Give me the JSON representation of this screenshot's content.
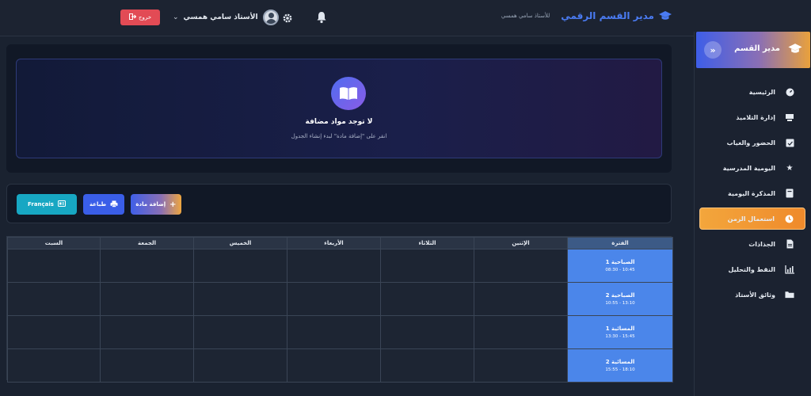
{
  "header": {
    "app_title": "مدير القسم الرقمي",
    "teacher_subtitle": "للأستاذ سامي همسي",
    "user_name": "الأستاذ سامي همسي",
    "logout_label": "خروج"
  },
  "sidebar": {
    "title": "مدير القسم",
    "items": [
      {
        "label": "الرئيسية",
        "icon": "dashboard-icon"
      },
      {
        "label": "إدارة التلاميذ",
        "icon": "students-icon"
      },
      {
        "label": "الحضور والغياب",
        "icon": "calendar-check-icon"
      },
      {
        "label": "اليومية المدرسية",
        "icon": "star-icon"
      },
      {
        "label": "المذكرة اليومية",
        "icon": "notebook-icon"
      },
      {
        "label": "استعمال الزمن",
        "icon": "clock-icon",
        "active": true
      },
      {
        "label": "الجذاذات",
        "icon": "file-icon"
      },
      {
        "label": "النقط والتحليل",
        "icon": "chart-icon"
      },
      {
        "label": "وثائق الأستاذ",
        "icon": "folder-icon"
      }
    ]
  },
  "empty_state": {
    "title": "لا توجد مواد مضافة",
    "subtitle": "انقر على \"إضافة مادة\" لبدء إنشاء الجدول"
  },
  "actions": {
    "french_label": "Français",
    "print_label": "طباعة",
    "add_subject_label": "إضافة مادة"
  },
  "timetable": {
    "columns": [
      "السبت",
      "الجمعة",
      "الخميس",
      "الأربعاء",
      "الثلاثاء",
      "الإثنين",
      "الفترة"
    ],
    "periods": [
      {
        "name": "الصباحية 1",
        "time": "08:30 - 10:45"
      },
      {
        "name": "الصباحية 2",
        "time": "10:55 - 13:10"
      },
      {
        "name": "المسائية 1",
        "time": "13:30 - 15:45"
      },
      {
        "name": "المسائية 2",
        "time": "15:55 - 18:10"
      }
    ]
  },
  "colors": {
    "accent_blue": "#4a7bf2",
    "active_orange": "#f3a63c",
    "logout_red": "#e24b55",
    "period_blue": "#4b86ea"
  }
}
